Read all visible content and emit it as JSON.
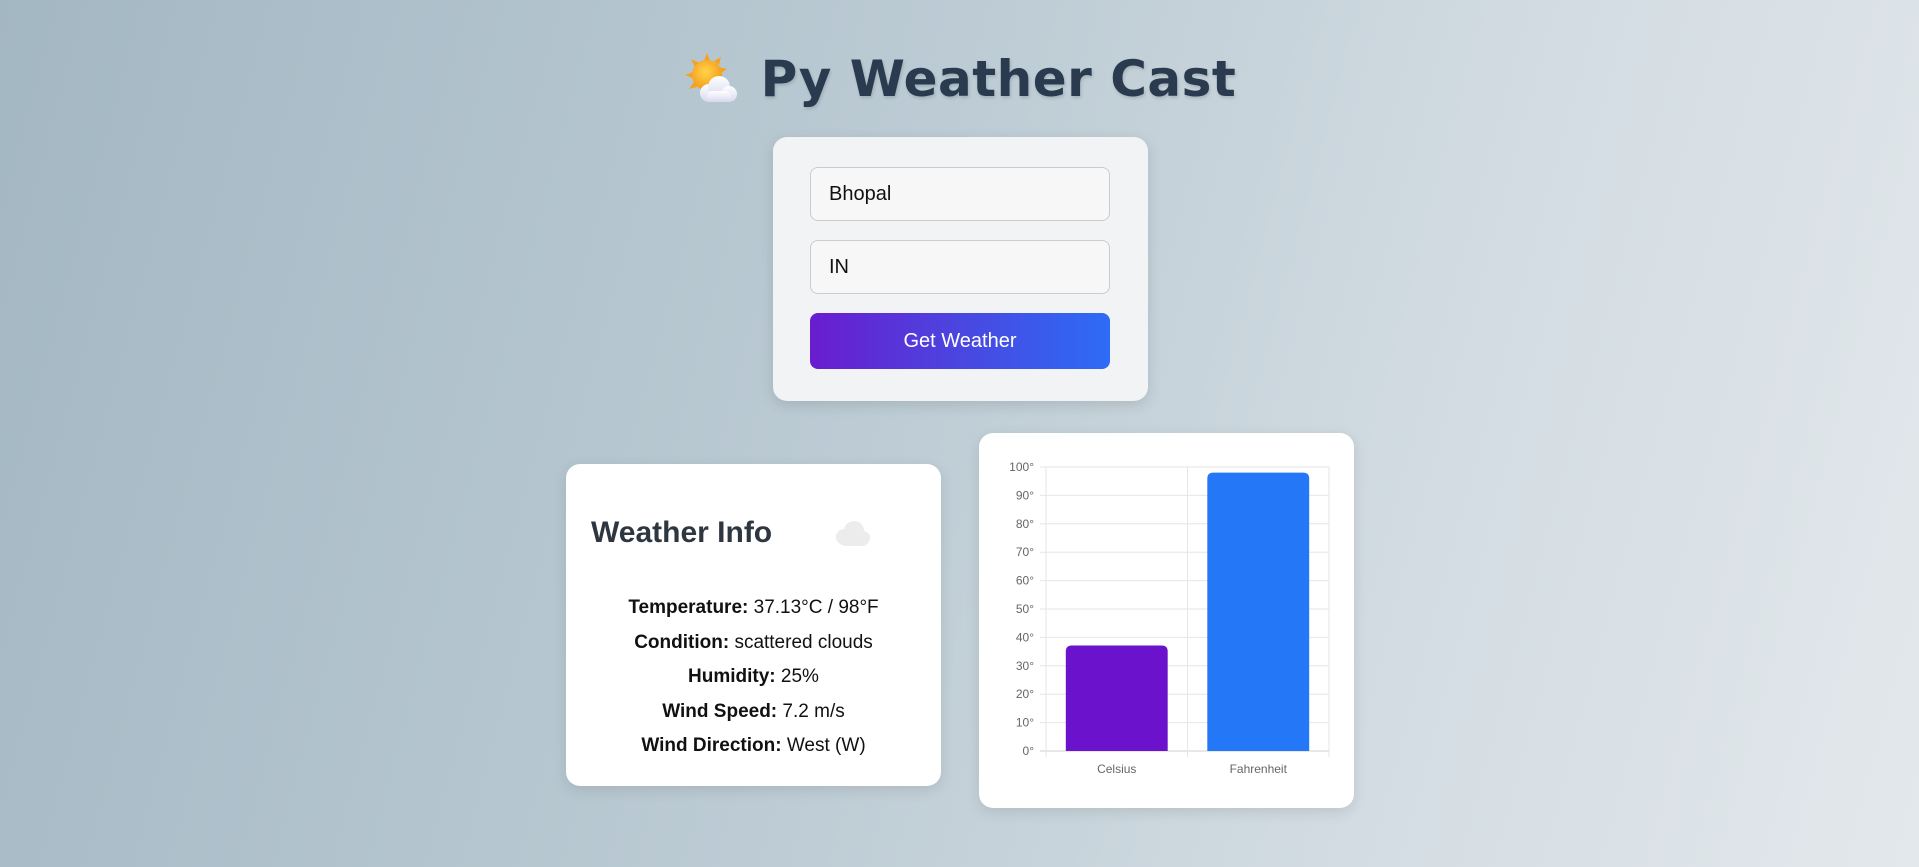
{
  "header": {
    "icon": "sun-behind-cloud-icon",
    "title": "Py Weather Cast"
  },
  "form": {
    "city_value": "Bhopal",
    "country_value": "IN",
    "submit_label": "Get Weather"
  },
  "weather_info": {
    "title": "Weather Info",
    "icon": "cloud-icon",
    "rows": [
      {
        "label": "Temperature:",
        "value": "37.13°C / 98°F"
      },
      {
        "label": "Condition:",
        "value": "scattered clouds"
      },
      {
        "label": "Humidity:",
        "value": "25%"
      },
      {
        "label": "Wind Speed:",
        "value": "7.2 m/s"
      },
      {
        "label": "Wind Direction:",
        "value": "West (W)"
      }
    ]
  },
  "chart_data": {
    "type": "bar",
    "categories": [
      "Celsius",
      "Fahrenheit"
    ],
    "values": [
      37.13,
      98
    ],
    "colors": [
      "#6a12cc",
      "#2478f8"
    ],
    "ylim": [
      0,
      100
    ],
    "yticks": [
      "0°",
      "10°",
      "20°",
      "30°",
      "40°",
      "50°",
      "60°",
      "70°",
      "80°",
      "90°",
      "100°"
    ],
    "grid": true
  },
  "colors": {
    "accent_start": "#6a1ccf",
    "accent_end": "#2d6cf6",
    "title": "#2b3b4f"
  }
}
